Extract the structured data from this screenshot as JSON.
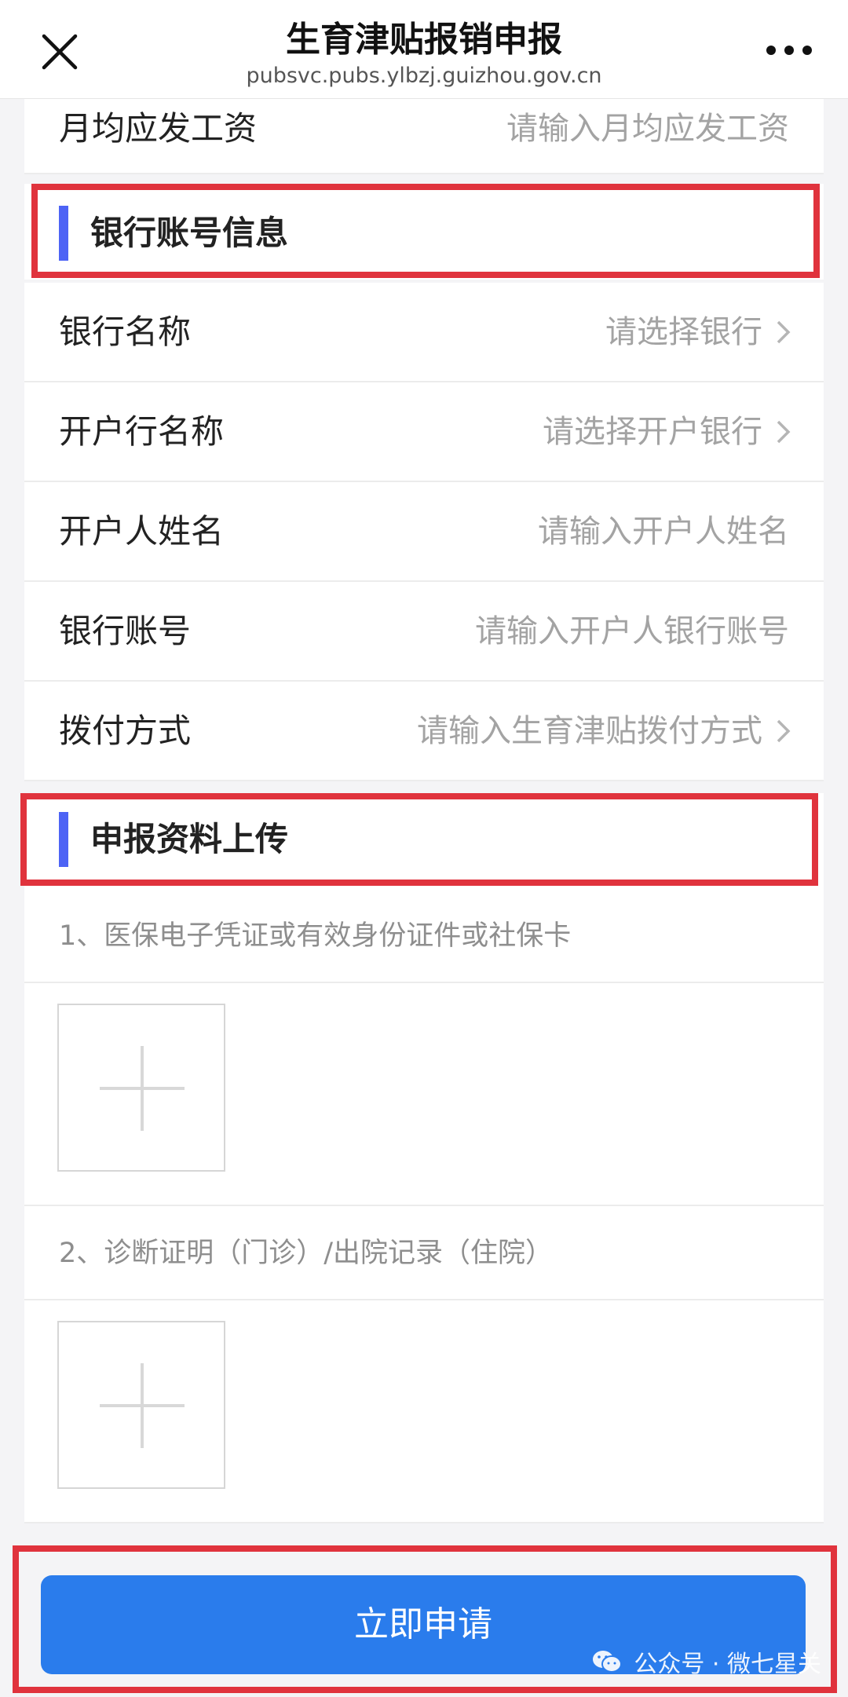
{
  "header": {
    "title": "生育津贴报销申报",
    "url": "pubsvc.pubs.ylbzj.guizhou.gov.cn"
  },
  "fields": {
    "monthly_salary": {
      "label": "月均应发工资",
      "placeholder": "请输入月均应发工资"
    }
  },
  "bank_section": {
    "title": "银行账号信息",
    "rows": [
      {
        "label": "银行名称",
        "placeholder": "请选择银行"
      },
      {
        "label": "开户行名称",
        "placeholder": "请选择开户银行"
      },
      {
        "label": "开户人姓名",
        "placeholder": "请输入开户人姓名"
      },
      {
        "label": "银行账号",
        "placeholder": "请输入开户人银行账号"
      },
      {
        "label": "拨付方式",
        "placeholder": "请输入生育津贴拨付方式"
      }
    ]
  },
  "upload_section": {
    "title": "申报资料上传",
    "items": [
      {
        "label": "1、医保电子凭证或有效身份证件或社保卡"
      },
      {
        "label": "2、诊断证明（门诊）/出院记录（住院）"
      }
    ]
  },
  "submit": {
    "label": "立即申请"
  },
  "watermark": {
    "text": "公众号 · 微七星关"
  },
  "colors": {
    "accent_bar": "#4d63f5",
    "button": "#2a7cec",
    "highlight_box": "#e0333d"
  }
}
